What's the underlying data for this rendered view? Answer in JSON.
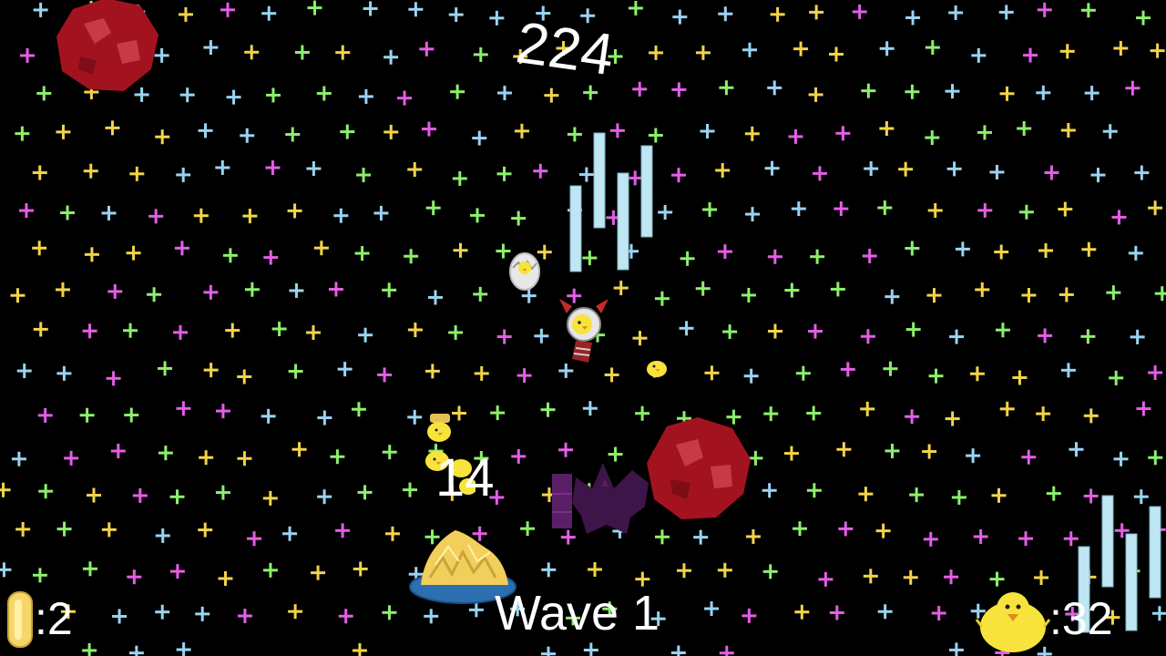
{
  "hud": {
    "score": "224",
    "combo": "14",
    "wave_label": "Wave 1",
    "coins": ":2",
    "chicks": ":32"
  },
  "icons": {
    "coin": "coin-icon",
    "chick": "chick-icon",
    "player": "chicken-spaceship",
    "egg": "hatching-egg",
    "nest": "egg-nest",
    "boss": "purple-bird-shadow",
    "asteroid": "red-asteroid"
  },
  "colors": {
    "background": "#000000",
    "hud_text": "#ffffff",
    "star_palette": [
      "#f2d44a",
      "#9ad4f2",
      "#e45ee6",
      "#8cf06c"
    ],
    "laser": "#bfe7f3",
    "asteroid": "#a3131f",
    "boss": "#3d1548",
    "coin": "#f5d66b",
    "chick": "#f7e33b"
  }
}
